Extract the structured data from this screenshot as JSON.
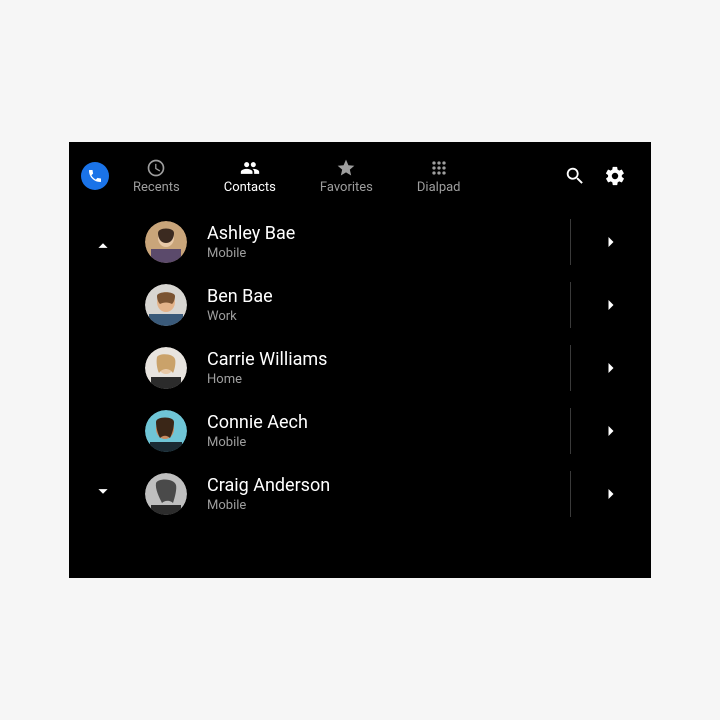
{
  "tabs": {
    "recents": "Recents",
    "contacts": "Contacts",
    "favorites": "Favorites",
    "dialpad": "Dialpad",
    "active": "contacts"
  },
  "contacts": [
    {
      "name": "Ashley Bae",
      "type": "Mobile"
    },
    {
      "name": "Ben Bae",
      "type": "Work"
    },
    {
      "name": "Carrie Williams",
      "type": "Home"
    },
    {
      "name": "Connie Aech",
      "type": "Mobile"
    },
    {
      "name": "Craig Anderson",
      "type": "Mobile"
    }
  ]
}
